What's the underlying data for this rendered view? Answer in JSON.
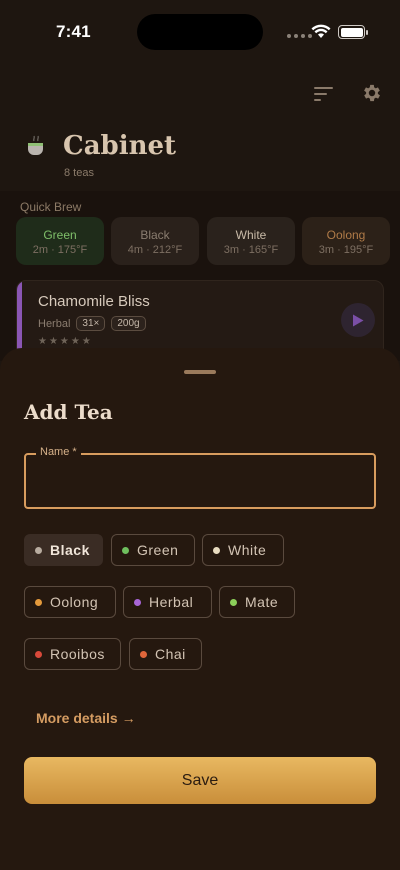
{
  "status_bar": {
    "time": "7:41"
  },
  "header": {
    "title": "Cabinet",
    "subtitle": "8 teas"
  },
  "quick_brew": {
    "label": "Quick Brew",
    "items": [
      {
        "name": "Green",
        "time": "2m · 175°F",
        "color": "#7fbf6a",
        "bg": "#1f2c1a"
      },
      {
        "name": "Black",
        "time": "4m · 212°F",
        "color": "#8a7d70",
        "bg": "#2a211b"
      },
      {
        "name": "White",
        "time": "3m · 165°F",
        "color": "#c9bba8",
        "bg": "#2a221c"
      },
      {
        "name": "Oolong",
        "time": "3m · 195°F",
        "color": "#b07b48",
        "bg": "#2c2118"
      }
    ]
  },
  "tea_card": {
    "name": "Chamomile Bliss",
    "type": "Herbal",
    "count": "31×",
    "weight": "200g",
    "stars": "★★★★★",
    "rating": 0,
    "accent": "#8a56b4"
  },
  "sheet": {
    "title": "Add Tea",
    "name_label": "Name *",
    "name_value": "",
    "types": [
      {
        "label": "Black",
        "dot": "#b8aca0",
        "selected": true
      },
      {
        "label": "Green",
        "dot": "#6fbf5e",
        "selected": false
      },
      {
        "label": "White",
        "dot": "#e8dcc0",
        "selected": false
      },
      {
        "label": "Oolong",
        "dot": "#e49a3c",
        "selected": false
      },
      {
        "label": "Herbal",
        "dot": "#a865d6",
        "selected": false
      },
      {
        "label": "Mate",
        "dot": "#8ccf5a",
        "selected": false
      },
      {
        "label": "Rooibos",
        "dot": "#d9493a",
        "selected": false
      },
      {
        "label": "Chai",
        "dot": "#e0663a",
        "selected": false
      }
    ],
    "more_details": "More details →",
    "save_label": "Save"
  },
  "colors": {
    "accent": "#d89c5e",
    "save_button": "#dca551"
  }
}
